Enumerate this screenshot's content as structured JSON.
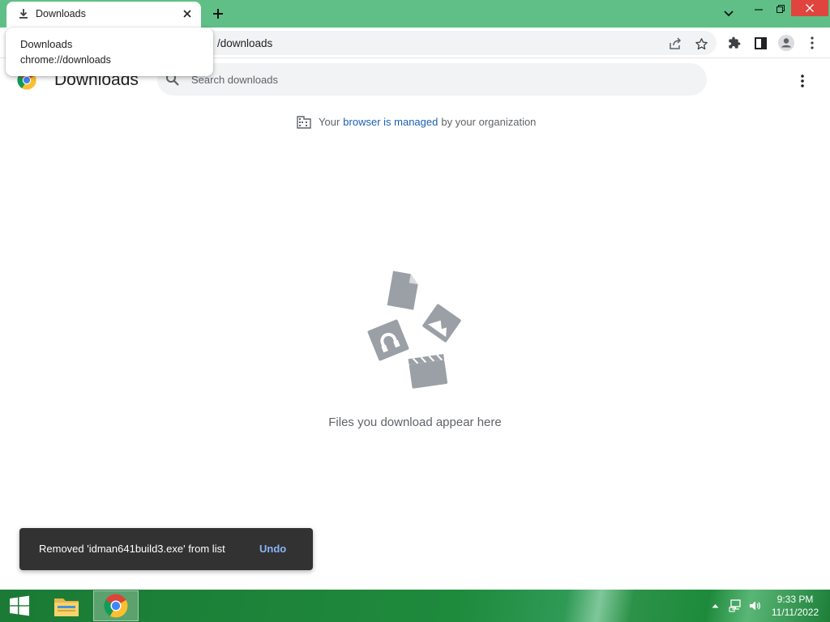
{
  "browser": {
    "tab": {
      "title": "Downloads",
      "icon": "download-icon"
    },
    "new_tab_icon": "plus-icon",
    "window_controls": [
      "chevron-down-icon",
      "minimize-icon",
      "restore-icon",
      "close-icon"
    ],
    "omnibox": {
      "url_visible": "/downloads"
    },
    "hover_card": {
      "title": "Downloads",
      "url": "chrome://downloads"
    },
    "toolbar_icons": [
      "share-icon",
      "star-icon",
      "extensions-icon",
      "side-panel-icon",
      "profile-icon",
      "menu-icon"
    ],
    "colors": {
      "frame": "#5fbf86",
      "link": "#1a5fb4",
      "toast_bg": "#323232",
      "toast_action": "#8ab4f8"
    }
  },
  "downloads_page": {
    "title": "Downloads",
    "search": {
      "placeholder": "Search downloads",
      "value": ""
    },
    "managed_notice": {
      "prefix": "Your",
      "link": "browser is managed",
      "suffix": "by your organization"
    },
    "empty_message": "Files you download appear here"
  },
  "toast": {
    "message": "Removed 'idman641build3.exe' from list",
    "action": "Undo"
  },
  "taskbar": {
    "apps": [
      "windows-start-icon",
      "file-explorer-icon",
      "chrome-icon"
    ],
    "tray_icons": [
      "tray-chevron-up-icon",
      "network-icon",
      "volume-icon"
    ],
    "time": "9:33 PM",
    "date": "11/11/2022"
  }
}
